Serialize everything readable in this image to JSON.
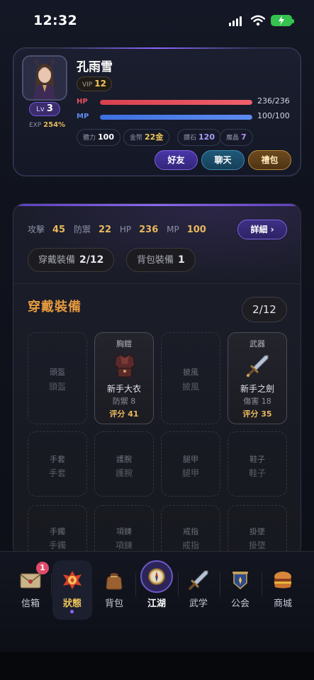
{
  "status_bar": {
    "time": "12:32"
  },
  "profile": {
    "name": "孔雨雪",
    "vip_label": "VIP",
    "vip_level": "12",
    "lv_label": "Lv",
    "level": "3",
    "exp_label": "EXP",
    "exp_value": "254%",
    "hp_label": "HP",
    "hp_value": "236/236",
    "hp_fraction": 1.0,
    "mp_label": "MP",
    "mp_value": "100/100",
    "mp_fraction": 1.0,
    "resources": [
      {
        "label": "體力",
        "value": "100",
        "color": "#ffffff"
      },
      {
        "label": "金幣",
        "value": "22金",
        "color": "#f1c65a"
      },
      {
        "label": "鑽石",
        "value": "120",
        "color": "#a99cff"
      },
      {
        "label": "魔晶",
        "value": "7",
        "color": "#b58cff"
      }
    ],
    "buttons": {
      "friends": "好友",
      "chat": "聊天",
      "gift": "禮包"
    }
  },
  "stats": [
    {
      "label": "攻擊",
      "value": "45"
    },
    {
      "label": "防禦",
      "value": "22"
    },
    {
      "label": "HP",
      "value": "236"
    },
    {
      "label": "MP",
      "value": "100"
    }
  ],
  "detail_button": "詳細 ›",
  "tabs": {
    "worn_label": "穿戴裝備",
    "worn_count": "2/12",
    "bag_label": "背包裝備",
    "bag_count": "1"
  },
  "section": {
    "title": "穿戴裝備",
    "count": "2/12"
  },
  "slots": [
    {
      "type": "empty",
      "a": "頭盔",
      "b": "頭盔"
    },
    {
      "type": "filled",
      "top": "胸鎧",
      "icon": "chest-armor-icon",
      "name": "新手大衣",
      "stat": "防禦 8",
      "score": "评分 41"
    },
    {
      "type": "empty",
      "a": "披風",
      "b": "披風"
    },
    {
      "type": "filled",
      "top": "武器",
      "icon": "sword-icon",
      "name": "新手之劍",
      "stat": "傷害 18",
      "score": "评分 35"
    },
    {
      "type": "empty",
      "a": "手套",
      "b": "手套"
    },
    {
      "type": "empty",
      "a": "護腕",
      "b": "護腕"
    },
    {
      "type": "empty",
      "a": "腿甲",
      "b": "腿甲"
    },
    {
      "type": "empty",
      "a": "鞋子",
      "b": "鞋子"
    },
    {
      "type": "empty",
      "a": "手鐲",
      "b": "手鐲"
    },
    {
      "type": "empty",
      "a": "項鍊",
      "b": "項鍊"
    },
    {
      "type": "empty",
      "a": "戒指",
      "b": "戒指"
    },
    {
      "type": "empty",
      "a": "掛墜",
      "b": "掛墜"
    }
  ],
  "nav": [
    {
      "label": "信箱",
      "icon": "mail-icon",
      "badge": "1"
    },
    {
      "label": "狀態",
      "icon": "status-icon",
      "active": true
    },
    {
      "label": "背包",
      "icon": "bag-icon"
    },
    {
      "label": "江湖",
      "icon": "compass-icon"
    },
    {
      "label": "武学",
      "icon": "martial-arts-icon"
    },
    {
      "label": "公会",
      "icon": "guild-icon"
    },
    {
      "label": "商城",
      "icon": "shop-icon"
    }
  ],
  "colors": {
    "hp": "#e8505e",
    "mp": "#4a7be8",
    "accent": "#7b61e0",
    "gold": "#e7b85b"
  }
}
